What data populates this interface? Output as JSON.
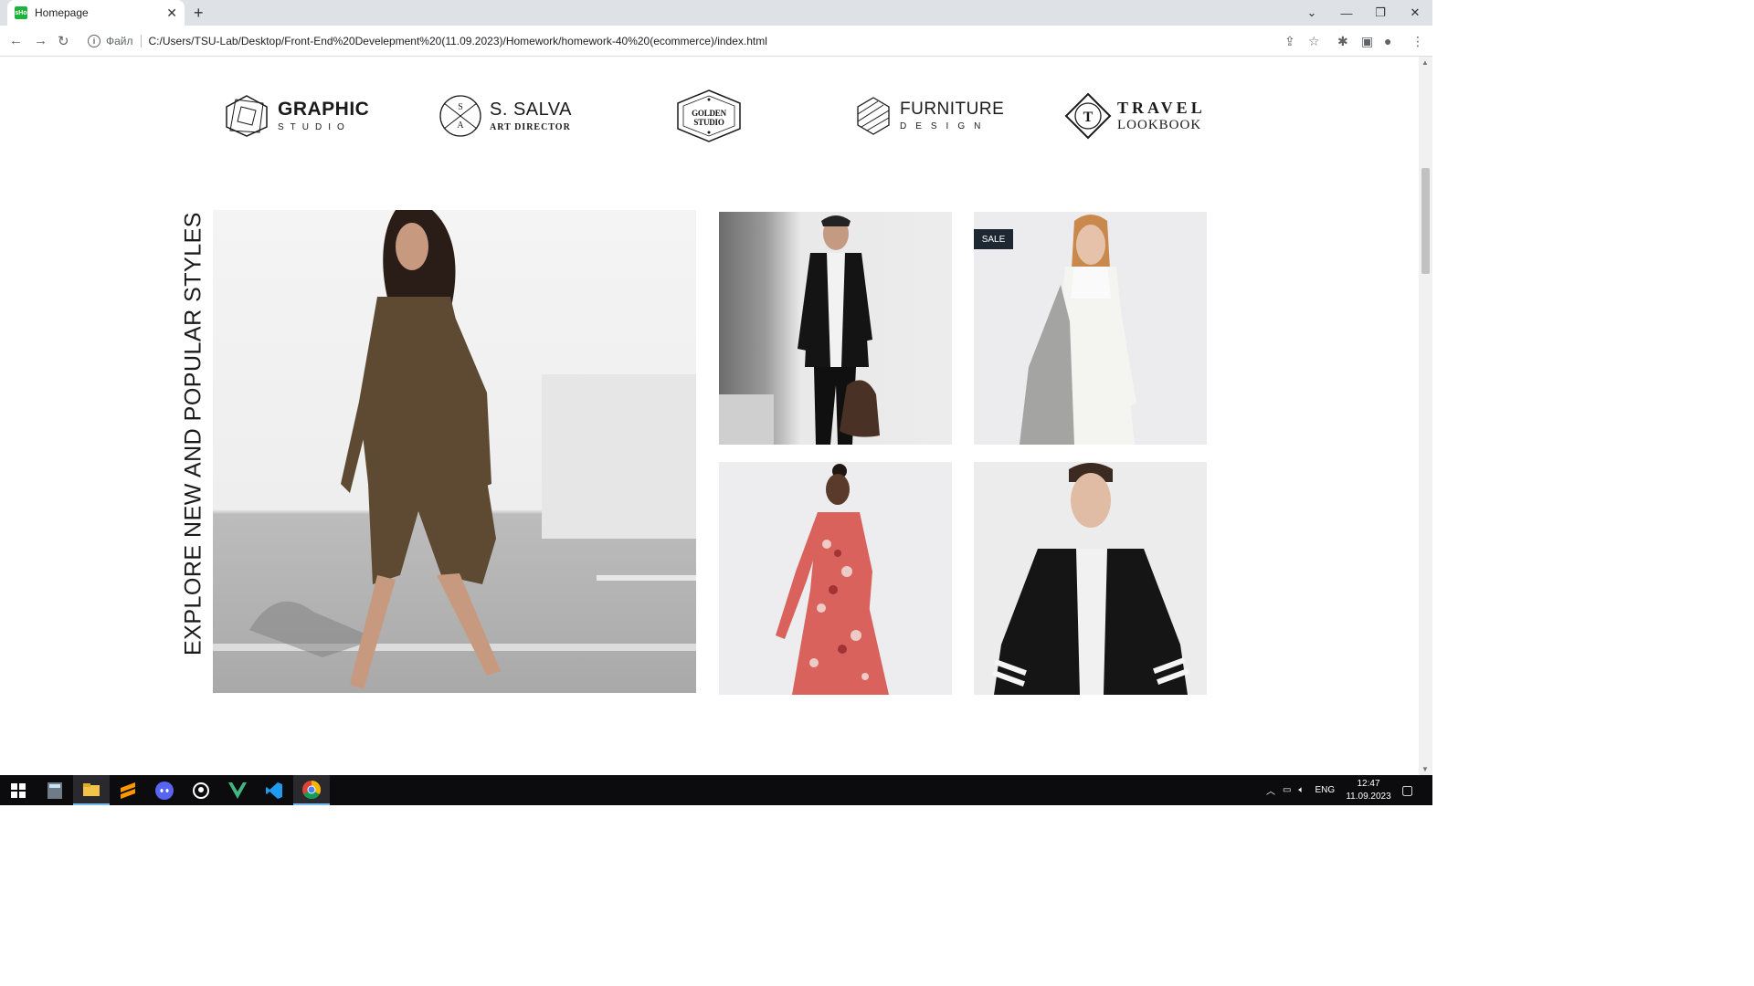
{
  "browser": {
    "tab_title": "Homepage",
    "favicon_text": "sHo",
    "url_scheme_label": "Файл",
    "url": "C:/Users/TSU-Lab/Desktop/Front-End%20Develepment%20(11.09.2023)/Homework/homework-40%20(ecommerce)/index.html",
    "icons": [
      "back-icon",
      "forward-icon",
      "reload-icon",
      "info-icon",
      "share-icon",
      "star-icon",
      "extensions-icon",
      "sidepanel-icon",
      "profile-icon",
      "menu-icon"
    ]
  },
  "brands": [
    {
      "line1": "GRAPHIC",
      "line2": "STUDIO"
    },
    {
      "line1": "S. SALVA",
      "line2": "ART DIRECTOR",
      "mark_letters": "SA"
    },
    {
      "line1": "GOLDEN STUDIO",
      "line2": ""
    },
    {
      "line1": "FURNITURE",
      "line2": "DESIGN"
    },
    {
      "line1": "TRAVEL",
      "line2": "LOOKBOOK",
      "mark_letter": "T"
    }
  ],
  "section": {
    "vertical_title": "EXPLORE NEW AND POPULAR STYLES",
    "badge": "SALE",
    "images": [
      "woman-brown-dress",
      "man-black-jacket",
      "woman-white-sweater",
      "woman-red-floral-dress",
      "man-black-cardigan"
    ]
  },
  "taskbar": {
    "apps": [
      "windows-start",
      "calculator",
      "file-explorer",
      "sublime-text",
      "discord",
      "github-desktop",
      "vue",
      "vscode",
      "chrome"
    ],
    "lang": "ENG",
    "time": "12:47",
    "date": "11.09.2023"
  },
  "colors": {
    "sale_badge": "#1e2833",
    "favicon": "#1db33d"
  }
}
